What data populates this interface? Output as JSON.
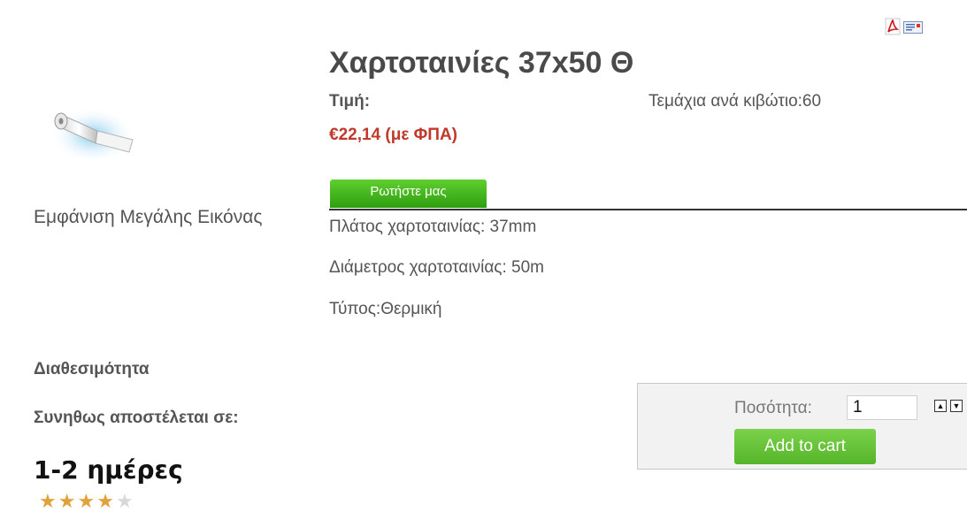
{
  "product": {
    "title": "Χαρτοταινίες 37x50 Θ",
    "price_label": "Τιμή:",
    "price_value": "€22,14 (με ΦΠΑ)",
    "units_per_box": "Τεμάχια ανά κιβώτιο:60",
    "big_image_link": "Εμφάνιση Μεγάλης Εικόνας",
    "ask_button": "Ρωτήστε μας",
    "specs": [
      "Πλάτος χαρτοταινίας: 37mm",
      "Διάμετρος χαρτοταινίας: 50m",
      "Τύπος:Θερμική"
    ]
  },
  "availability": {
    "label": "Διαθεσιμότητα",
    "ships_label": "Συνηθως αποστέλεται σε:",
    "ships_value": "1-2 ημέρες"
  },
  "rating": {
    "value": 4,
    "max": 5
  },
  "cart": {
    "quantity_label": "Ποσότητα:",
    "quantity_value": "1",
    "add_to_cart": "Add to cart"
  },
  "icons": {
    "pdf": "pdf-icon",
    "email": "email-icon",
    "qty_up": "arrow-up-icon",
    "qty_down": "arrow-down-icon"
  },
  "colors": {
    "price": "#c0392b",
    "button_green": "#2e9e10",
    "cart_green": "#55b52a",
    "star": "#e0a23a"
  }
}
